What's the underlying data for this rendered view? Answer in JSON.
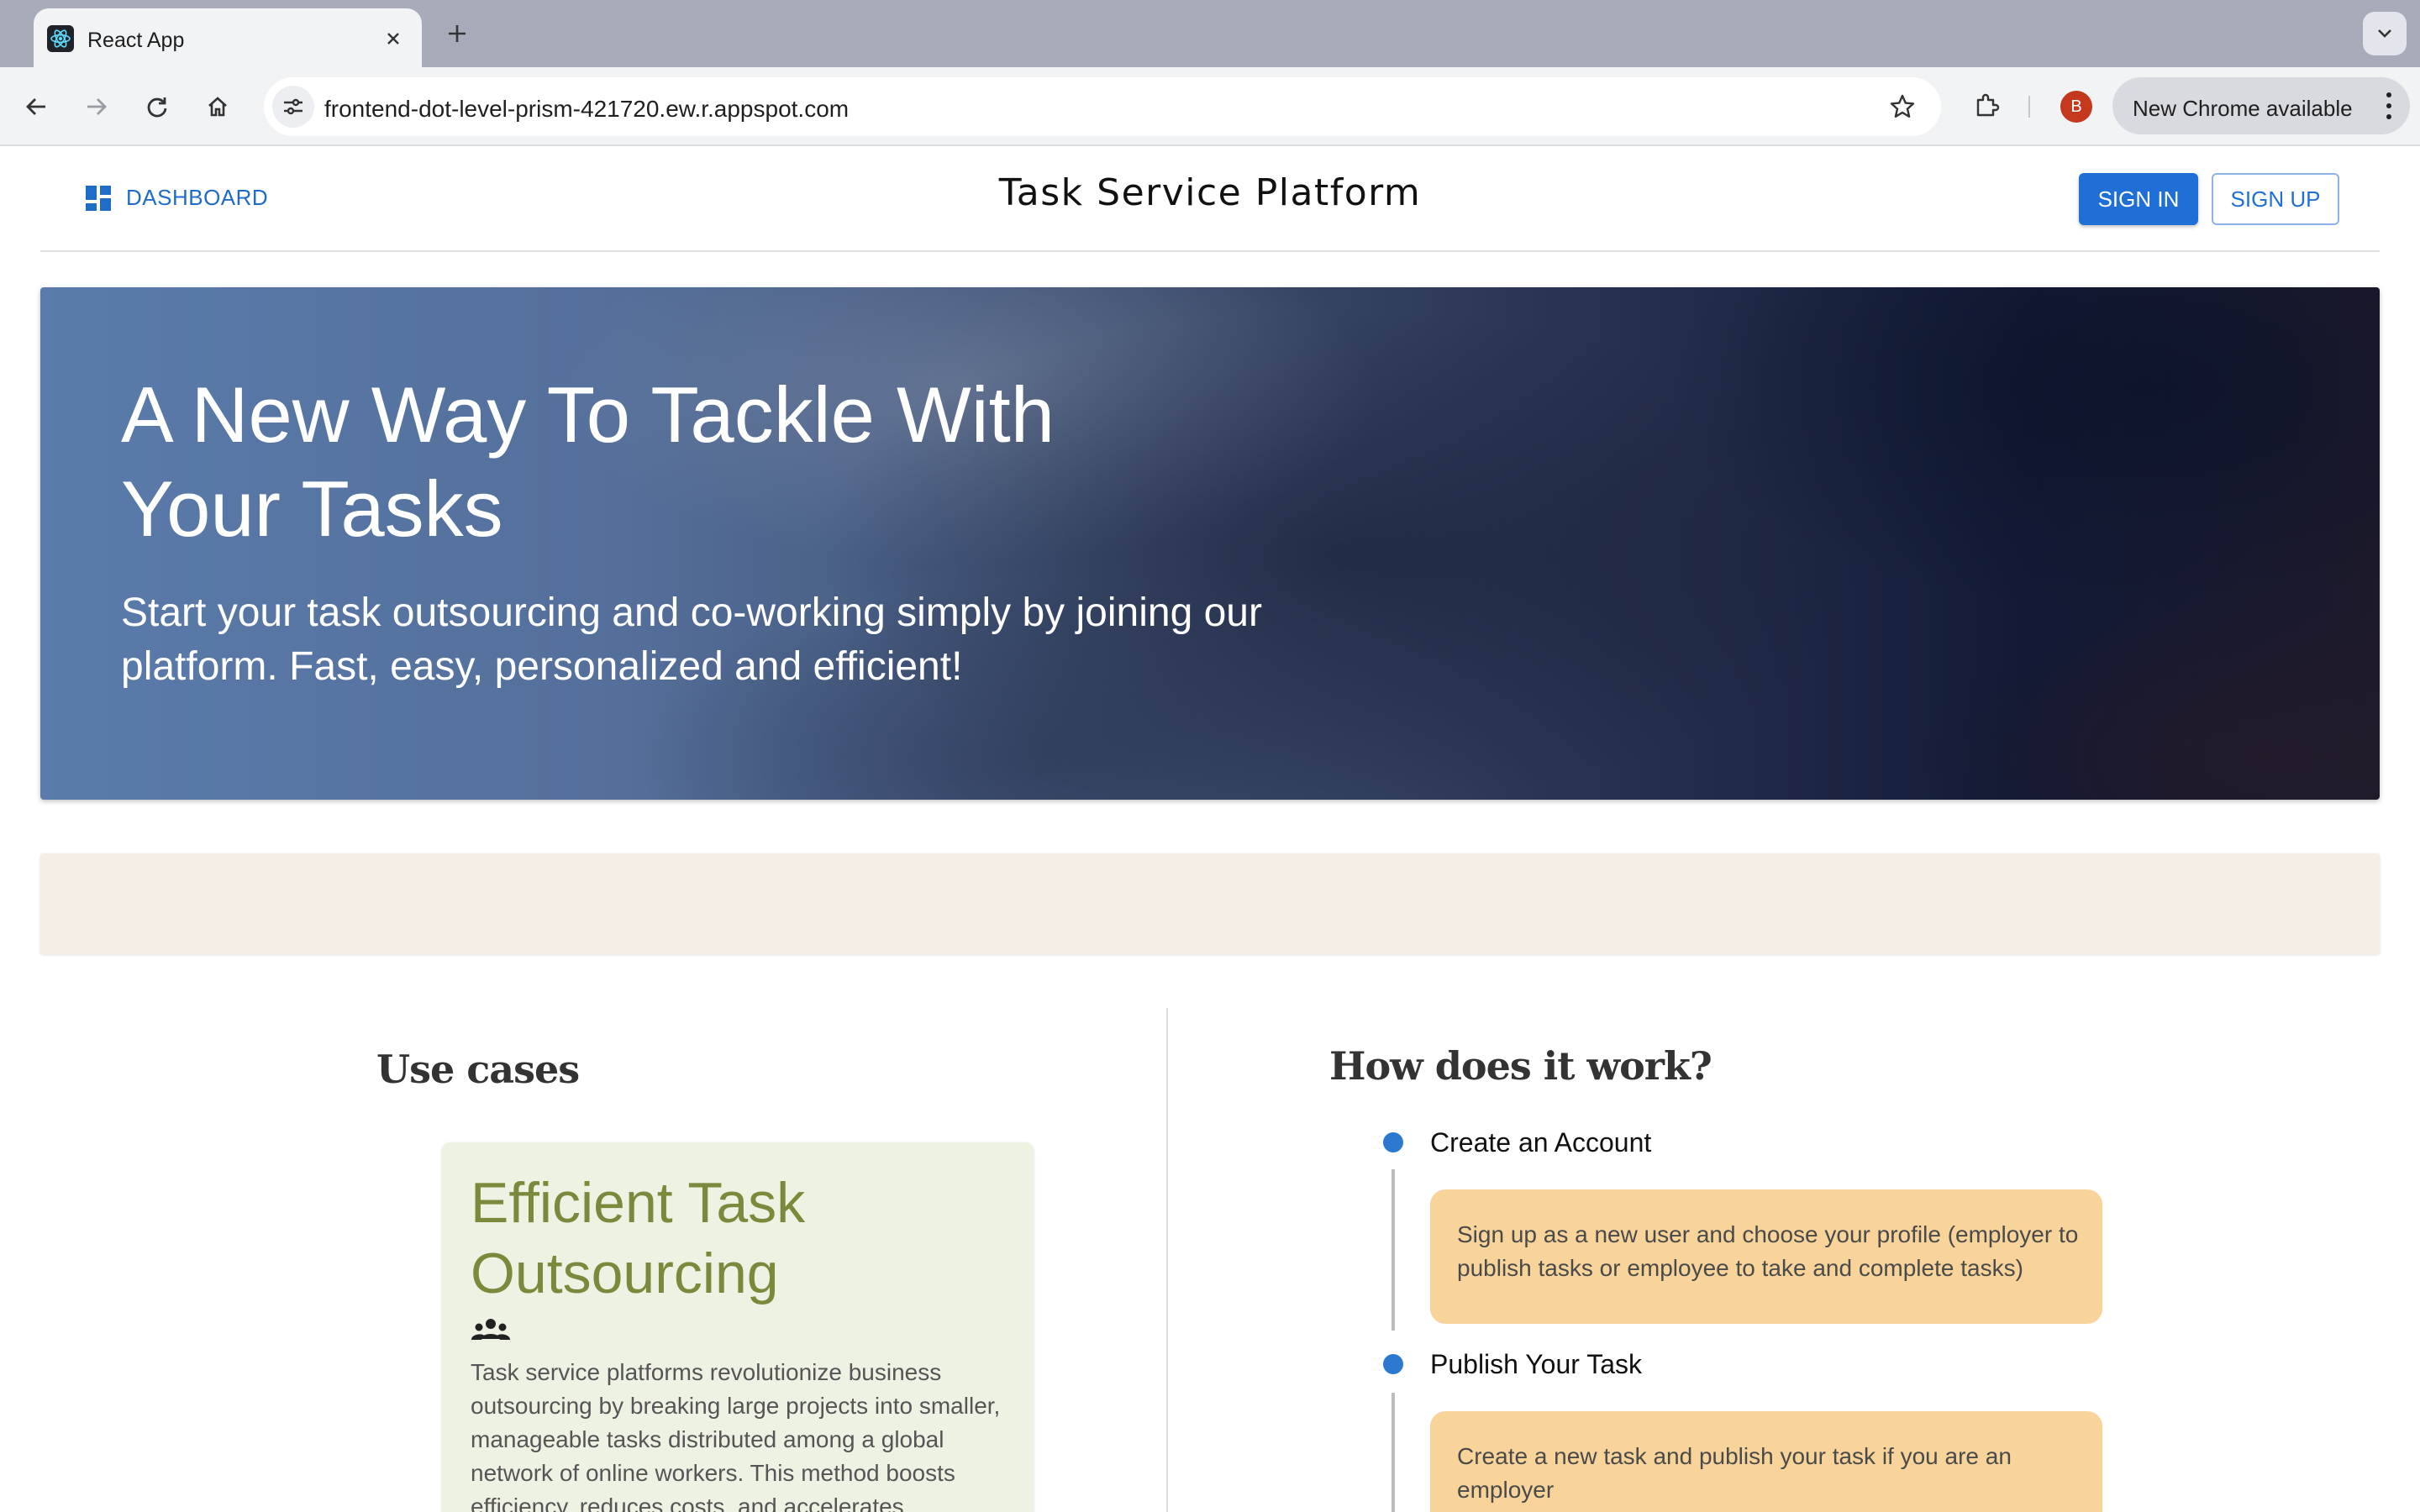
{
  "browser": {
    "tab_title": "React App",
    "url": "frontend-dot-level-prism-421720.ew.r.appspot.com",
    "profile_initial": "B",
    "update_label": "New Chrome available",
    "icons": [
      "react-favicon-icon",
      "close-icon",
      "plus-icon",
      "chevron-down-icon",
      "back-arrow-icon",
      "forward-arrow-icon",
      "reload-icon",
      "home-icon",
      "site-info-icon",
      "star-icon",
      "extensions-icon",
      "more-vert-icon"
    ]
  },
  "header": {
    "dashboard_label": "DASHBOARD",
    "brand": "Task Service Platform",
    "sign_in": "SIGN IN",
    "sign_up": "SIGN UP"
  },
  "hero": {
    "title": "A New Way To Tackle With Your Tasks",
    "subtitle": "Start your task outsourcing and co-working simply by joining our platform. Fast, easy, personalized and efficient!"
  },
  "use_cases": {
    "heading": "Use cases",
    "card": {
      "title": "Efficient Task Outsourcing",
      "icon": "groups-icon",
      "text": "Task service platforms revolutionize business outsourcing by breaking large projects into smaller, manageable tasks distributed among a global network of online workers. This method boosts efficiency, reduces costs, and accelerates"
    }
  },
  "how_it_works": {
    "heading": "How does it work?",
    "steps": [
      {
        "title": "Create an Account",
        "text": "Sign up as a new user and choose your profile (employer to publish tasks or employee to take and complete tasks)"
      },
      {
        "title": "Publish Your Task",
        "text": "Create a new task and publish your task if you are an employer"
      }
    ]
  },
  "colors": {
    "primary": "#1f6fd6",
    "card_green_bg": "#eef2e2",
    "card_green_title": "#7a8a3c",
    "step_card_bg": "#f8d49b",
    "band_beige": "#f5eee4"
  }
}
